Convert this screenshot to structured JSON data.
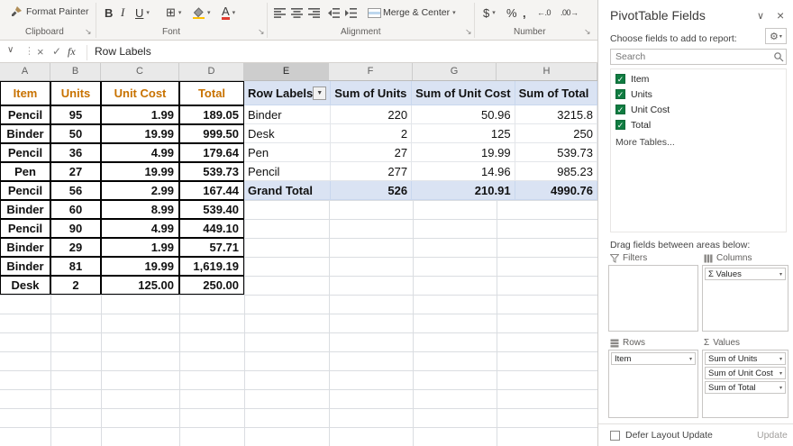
{
  "icons": {
    "bold": "B",
    "italic": "I",
    "underline": "U",
    "borders": "⊞",
    "font_color": "A",
    "accounting": "$",
    "percent": "%",
    "comma": ",",
    "increase_decimal": "←.0",
    "decrease_decimal": ".00→",
    "dropdown": "▾",
    "dialog_launcher": "↘",
    "name_box_chevron": "∨",
    "separator_dots": "⋮",
    "cancel": "×",
    "check": "✓",
    "fx": "fx",
    "gear": "⚙",
    "pane_chevron": "∨",
    "close": "×",
    "filter_arrow": "▼",
    "sigma": "Σ"
  },
  "ribbon": {
    "format_painter": "Format Painter",
    "merge_center": "Merge & Center",
    "groups": [
      {
        "label": "Clipboard"
      },
      {
        "label": "Font"
      },
      {
        "label": "Alignment"
      },
      {
        "label": "Number"
      }
    ]
  },
  "formula_bar": {
    "content": "Row Labels"
  },
  "sheet": {
    "column_letters": [
      "A",
      "B",
      "C",
      "D",
      "E",
      "F",
      "G",
      "H"
    ],
    "active_column": "E",
    "data_table": {
      "headers": [
        "Item",
        "Units",
        "Unit Cost",
        "Total"
      ],
      "rows": [
        [
          "Pencil",
          "95",
          "1.99",
          "189.05"
        ],
        [
          "Binder",
          "50",
          "19.99",
          "999.50"
        ],
        [
          "Pencil",
          "36",
          "4.99",
          "179.64"
        ],
        [
          "Pen",
          "27",
          "19.99",
          "539.73"
        ],
        [
          "Pencil",
          "56",
          "2.99",
          "167.44"
        ],
        [
          "Binder",
          "60",
          "8.99",
          "539.40"
        ],
        [
          "Pencil",
          "90",
          "4.99",
          "449.10"
        ],
        [
          "Binder",
          "29",
          "1.99",
          "57.71"
        ],
        [
          "Binder",
          "81",
          "19.99",
          "1,619.19"
        ],
        [
          "Desk",
          "2",
          "125.00",
          "250.00"
        ]
      ]
    },
    "pivot_table": {
      "headers": [
        "Row Labels",
        "Sum of Units",
        "Sum of Unit Cost",
        "Sum of Total"
      ],
      "rows": [
        [
          "Binder",
          "220",
          "50.96",
          "3215.8"
        ],
        [
          "Desk",
          "2",
          "125",
          "250"
        ],
        [
          "Pen",
          "27",
          "19.99",
          "539.73"
        ],
        [
          "Pencil",
          "277",
          "14.96",
          "985.23"
        ]
      ],
      "grand_total": [
        "Grand Total",
        "526",
        "210.91",
        "4990.76"
      ]
    }
  },
  "pane": {
    "title": "PivotTable Fields",
    "choose_fields": "Choose fields to add to report:",
    "search_placeholder": "Search",
    "fields": [
      {
        "label": "Item",
        "checked": true
      },
      {
        "label": "Units",
        "checked": true
      },
      {
        "label": "Unit Cost",
        "checked": true
      },
      {
        "label": "Total",
        "checked": true
      }
    ],
    "more_tables": "More Tables...",
    "drag_text": "Drag fields between areas below:",
    "areas": {
      "filters_label": "Filters",
      "columns_label": "Columns",
      "rows_label": "Rows",
      "values_label": "Values",
      "columns_items": [
        "Σ Values"
      ],
      "rows_items": [
        "Item"
      ],
      "values_items": [
        "Sum of Units",
        "Sum of Unit Cost",
        "Sum of Total"
      ]
    },
    "defer_label": "Defer Layout Update",
    "update_label": "Update"
  },
  "colors": {
    "table_header_text": "#C87200",
    "pivot_band": "#DAE3F3",
    "checkbox_green": "#107C41",
    "font_color_bar": "#E03C31"
  }
}
